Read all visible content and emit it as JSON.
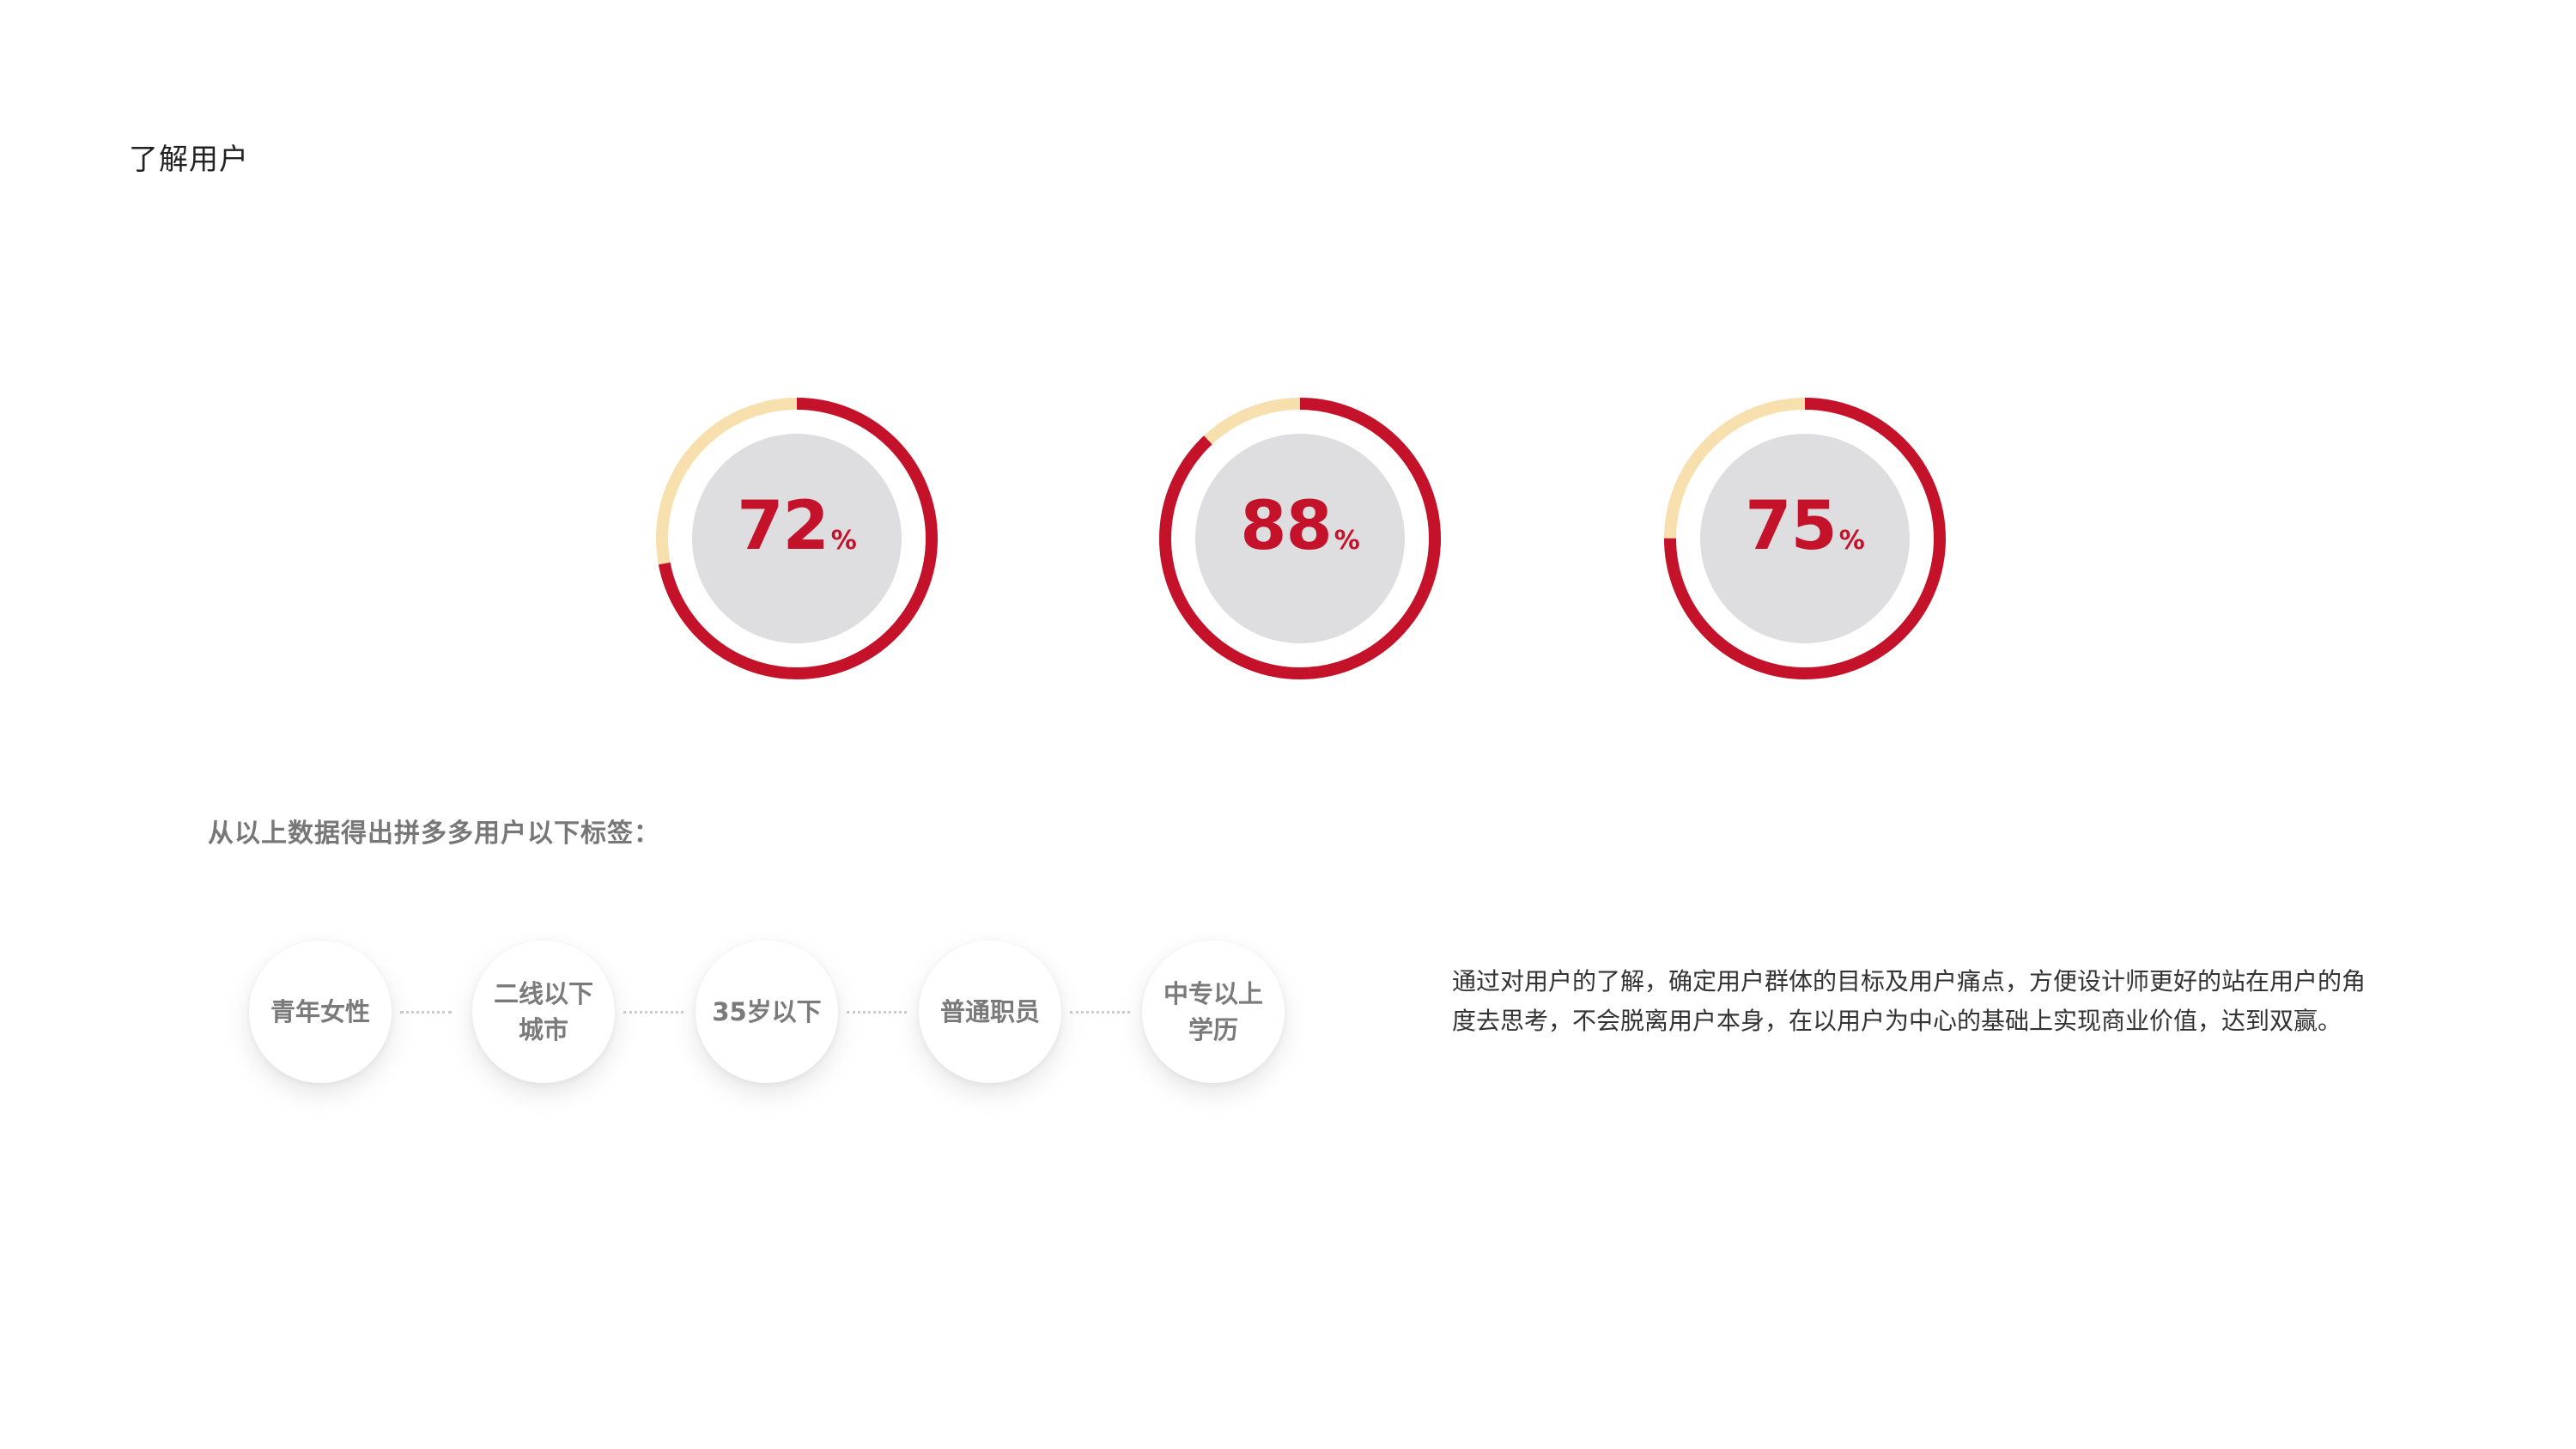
{
  "title": "了解用户",
  "rings": [
    {
      "value": 72,
      "label": "72",
      "unit": "%"
    },
    {
      "value": 88,
      "label": "88",
      "unit": "%"
    },
    {
      "value": 75,
      "label": "75",
      "unit": "%"
    }
  ],
  "colors": {
    "accent": "#c4122a",
    "remainder": "#f8e0ae",
    "inner": "#dedee0"
  },
  "intro": "从以上数据得出拼多多用户以下标签：",
  "tags": [
    {
      "line1": "青年女性",
      "line2": ""
    },
    {
      "line1": "二线以下",
      "line2": "城市"
    },
    {
      "line1": "35岁以下",
      "line2": ""
    },
    {
      "line1": "普通职员",
      "line2": ""
    },
    {
      "line1": "中专以上",
      "line2": "学历"
    }
  ],
  "description": {
    "line1": "通过对用户的了解，确定用户群体的目标及用户痛点，方便设计师更好的站在用户的角",
    "line2": "度去思考，不会脱离用户本身，在以用户为中心的基础上实现商业价值，达到双赢。"
  }
}
